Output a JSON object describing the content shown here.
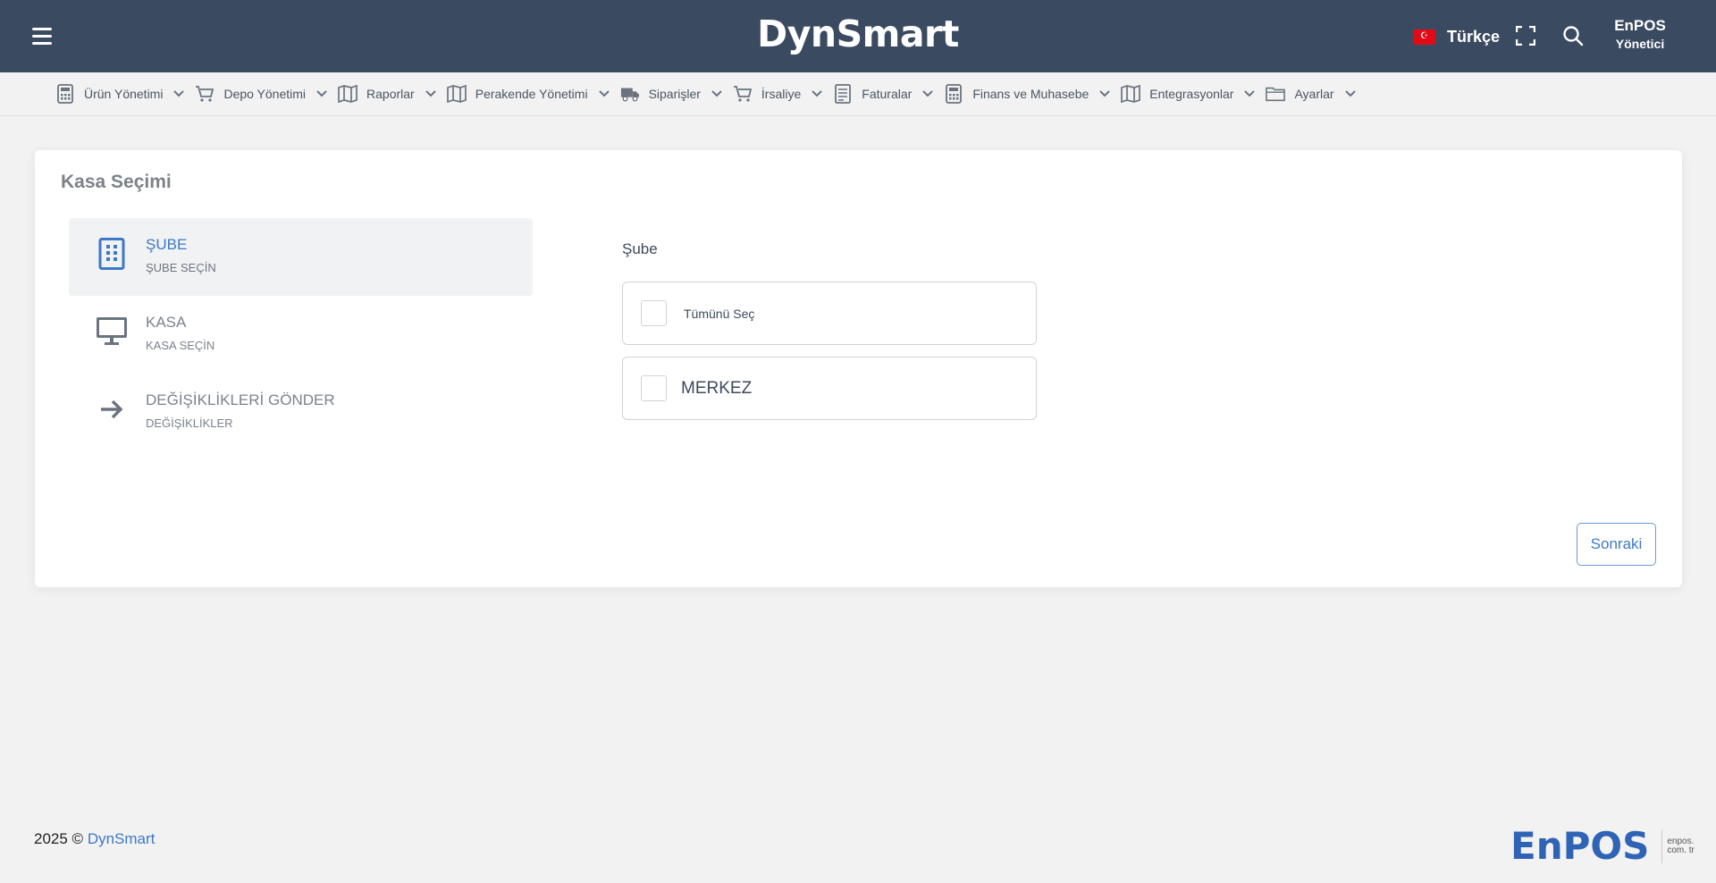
{
  "header": {
    "brand": "DynSmart",
    "language": "Türkçe",
    "user_name": "EnPOS",
    "user_role": "Yönetici",
    "bg_color": "#3a4a61"
  },
  "menu": [
    {
      "label": "Ürün Yönetimi",
      "icon": "calculator-icon"
    },
    {
      "label": "Depo Yönetimi",
      "icon": "cart-icon"
    },
    {
      "label": "Raporlar",
      "icon": "map-icon"
    },
    {
      "label": "Perakende Yönetimi",
      "icon": "map-icon"
    },
    {
      "label": "Siparişler",
      "icon": "truck-icon"
    },
    {
      "label": "İrsaliye",
      "icon": "cart-icon"
    },
    {
      "label": "Faturalar",
      "icon": "document-icon"
    },
    {
      "label": "Finans ve Muhasebe",
      "icon": "calculator-icon"
    },
    {
      "label": "Entegrasyonlar",
      "icon": "map-icon"
    },
    {
      "label": "Ayarlar",
      "icon": "folder-icon"
    }
  ],
  "card": {
    "title": "Kasa Seçimi",
    "steps": [
      {
        "title": "ŞUBE",
        "subtitle": "ŞUBE SEÇİN",
        "icon": "building-icon",
        "active": true
      },
      {
        "title": "KASA",
        "subtitle": "KASA SEÇİN",
        "icon": "monitor-icon",
        "active": false
      },
      {
        "title": "DEĞİŞİKLİKLERİ GÖNDER",
        "subtitle": "DEĞİŞİKLİKLER",
        "icon": "arrow-right-icon",
        "active": false
      }
    ],
    "field_label": "Şube",
    "select_all_label": "Tümünü Seç",
    "options": [
      "MERKEZ"
    ],
    "next_label": "Sonraki",
    "accent_color": "#3e79c7"
  },
  "footer": {
    "copyright": "2025 ©",
    "copyright_link": "DynSmart",
    "logo_text": "EnPOS",
    "logo_domain": "enpos. com. tr"
  }
}
